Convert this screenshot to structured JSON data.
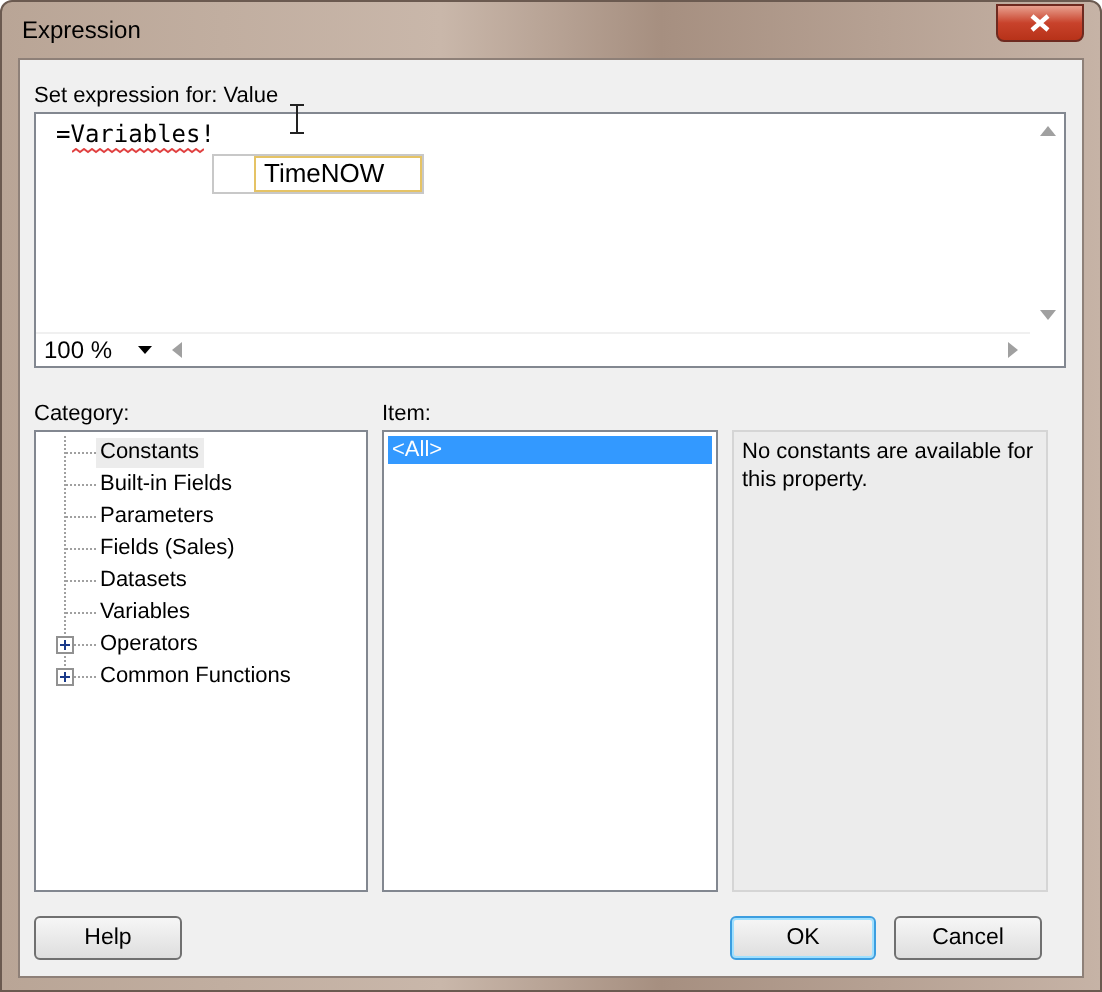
{
  "window": {
    "title": "Expression"
  },
  "expression": {
    "label": "Set expression for: Value",
    "value": "=Variables!",
    "spelling_error": true,
    "zoom": "100 %",
    "suggestions": [
      {
        "label": "TimeNOW",
        "selected": true
      }
    ]
  },
  "category": {
    "label": "Category:",
    "items": [
      {
        "label": "Constants",
        "kind": "leaf",
        "selected": true
      },
      {
        "label": "Built-in Fields",
        "kind": "leaf",
        "selected": false
      },
      {
        "label": "Parameters",
        "kind": "leaf",
        "selected": false
      },
      {
        "label": "Fields (Sales)",
        "kind": "leaf",
        "selected": false
      },
      {
        "label": "Datasets",
        "kind": "leaf",
        "selected": false
      },
      {
        "label": "Variables",
        "kind": "leaf",
        "selected": false
      },
      {
        "label": "Operators",
        "kind": "group",
        "expanded": false,
        "selected": false
      },
      {
        "label": "Common Functions",
        "kind": "group",
        "expanded": false,
        "selected": false
      }
    ]
  },
  "item": {
    "label": "Item:",
    "items": [
      {
        "label": "<All>",
        "selected": true
      }
    ]
  },
  "description": "No constants are available for this property.",
  "buttons": [
    {
      "label": "Help",
      "default": false
    },
    {
      "label": "OK",
      "default": true
    },
    {
      "label": "Cancel",
      "default": false
    }
  ]
}
